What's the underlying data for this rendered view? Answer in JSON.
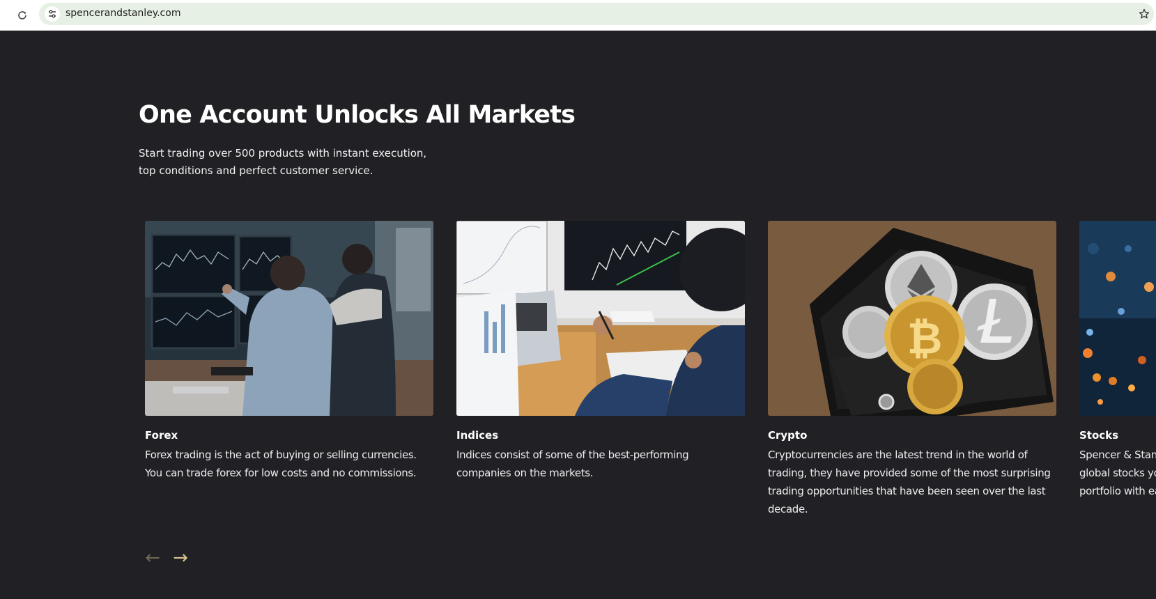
{
  "browser": {
    "url": "spencerandstanley.com"
  },
  "section": {
    "heading": "One Account Unlocks All Markets",
    "subtitle": "Start trading over 500 products with instant execution, top conditions and perfect customer service."
  },
  "cards": [
    {
      "title": "Forex",
      "text": "Forex trading is the act of buying or selling currencies. You can trade forex for low costs and no commissions."
    },
    {
      "title": "Indices",
      "text": "Indices consist of some of the best-performing companies on the markets."
    },
    {
      "title": "Crypto",
      "text": "Cryptocurrencies are the latest trend in the world of trading, they have provided some of the most surprising trading opportunities that have been seen over the last decade."
    },
    {
      "title": "Stocks",
      "text": "Spencer & Stan global stocks yo portfolio with ea"
    }
  ],
  "carousel": {
    "prev_arrow": "←",
    "next_arrow": "→",
    "prev_color": "#6e6a54",
    "next_color": "#d8c690"
  },
  "colors": {
    "background": "#212025",
    "heading": "#ffffff",
    "body_text": "#ececec",
    "accent": "#d8c690"
  },
  "icons": {
    "reload": "reload-icon",
    "site_info": "tune-icon",
    "bookmark": "star-icon"
  }
}
